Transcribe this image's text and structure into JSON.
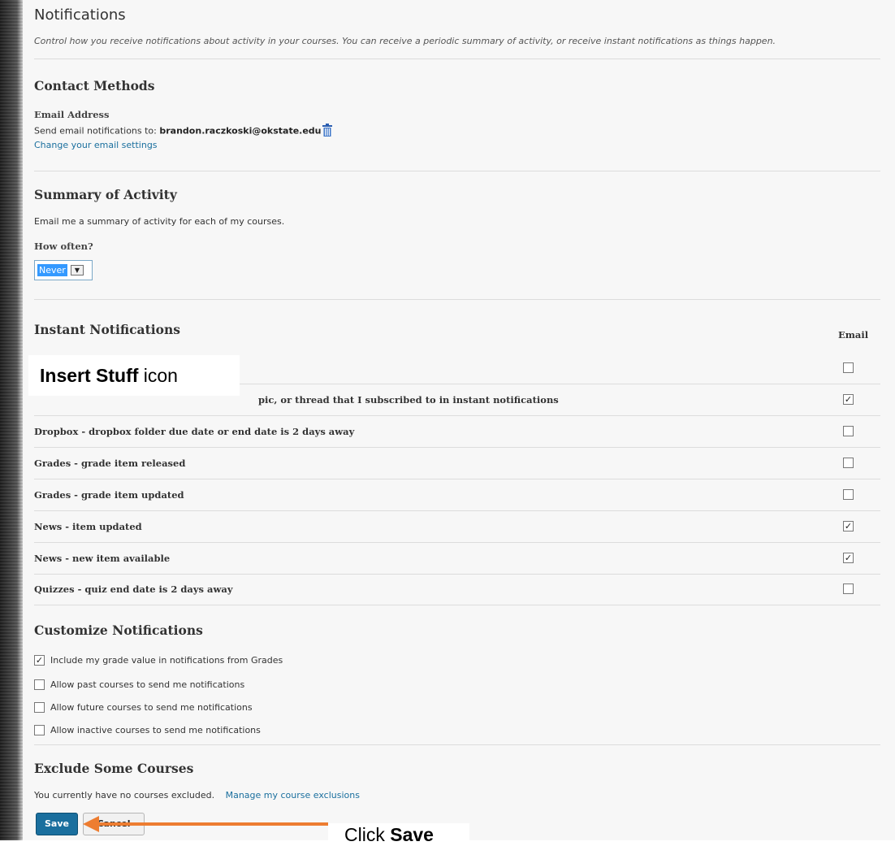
{
  "header": {
    "title": "Notifications",
    "description": "Control how you receive notifications about activity in your courses. You can receive a periodic summary of activity, or receive instant notifications as things happen."
  },
  "contact": {
    "heading": "Contact Methods",
    "email_label": "Email Address",
    "send_prefix": "Send email notifications to: ",
    "email": "brandon.raczkoski@okstate.edu",
    "change_link": "Change your email settings"
  },
  "summary": {
    "heading": "Summary of Activity",
    "text": "Email me a summary of activity for each of my courses.",
    "how_often": "How often?",
    "selected": "Never"
  },
  "instant": {
    "heading": "Instant Notifications",
    "email_col": "Email",
    "rows": [
      {
        "label": "",
        "checked": false
      },
      {
        "label": "pic, or thread that I subscribed to in instant notifications",
        "checked": true
      },
      {
        "label": "Dropbox - dropbox folder due date or end date is 2 days away",
        "checked": false
      },
      {
        "label": "Grades - grade item released",
        "checked": false
      },
      {
        "label": "Grades - grade item updated",
        "checked": false
      },
      {
        "label": "News - item updated",
        "checked": true
      },
      {
        "label": "News - new item available",
        "checked": true
      },
      {
        "label": "Quizzes - quiz end date is 2 days away",
        "checked": false
      }
    ]
  },
  "customize": {
    "heading": "Customize Notifications",
    "options": [
      {
        "label": "Include my grade value in notifications from Grades",
        "checked": true
      },
      {
        "label": "Allow past courses to send me notifications",
        "checked": false
      },
      {
        "label": "Allow future courses to send me notifications",
        "checked": false
      },
      {
        "label": "Allow inactive courses to send me notifications",
        "checked": false
      }
    ]
  },
  "exclude": {
    "heading": "Exclude Some Courses",
    "text": "You currently have no courses excluded.",
    "link": "Manage my course exclusions"
  },
  "buttons": {
    "save": "Save",
    "cancel": "Cancel"
  },
  "annotations": {
    "insert_bold": "Insert Stuff",
    "insert_rest": " icon",
    "click_plain": "Click ",
    "click_bold": "Save",
    "arrow_color": "#ed7d31"
  },
  "icons": {
    "check": "✓",
    "select_arrow": "▼"
  }
}
